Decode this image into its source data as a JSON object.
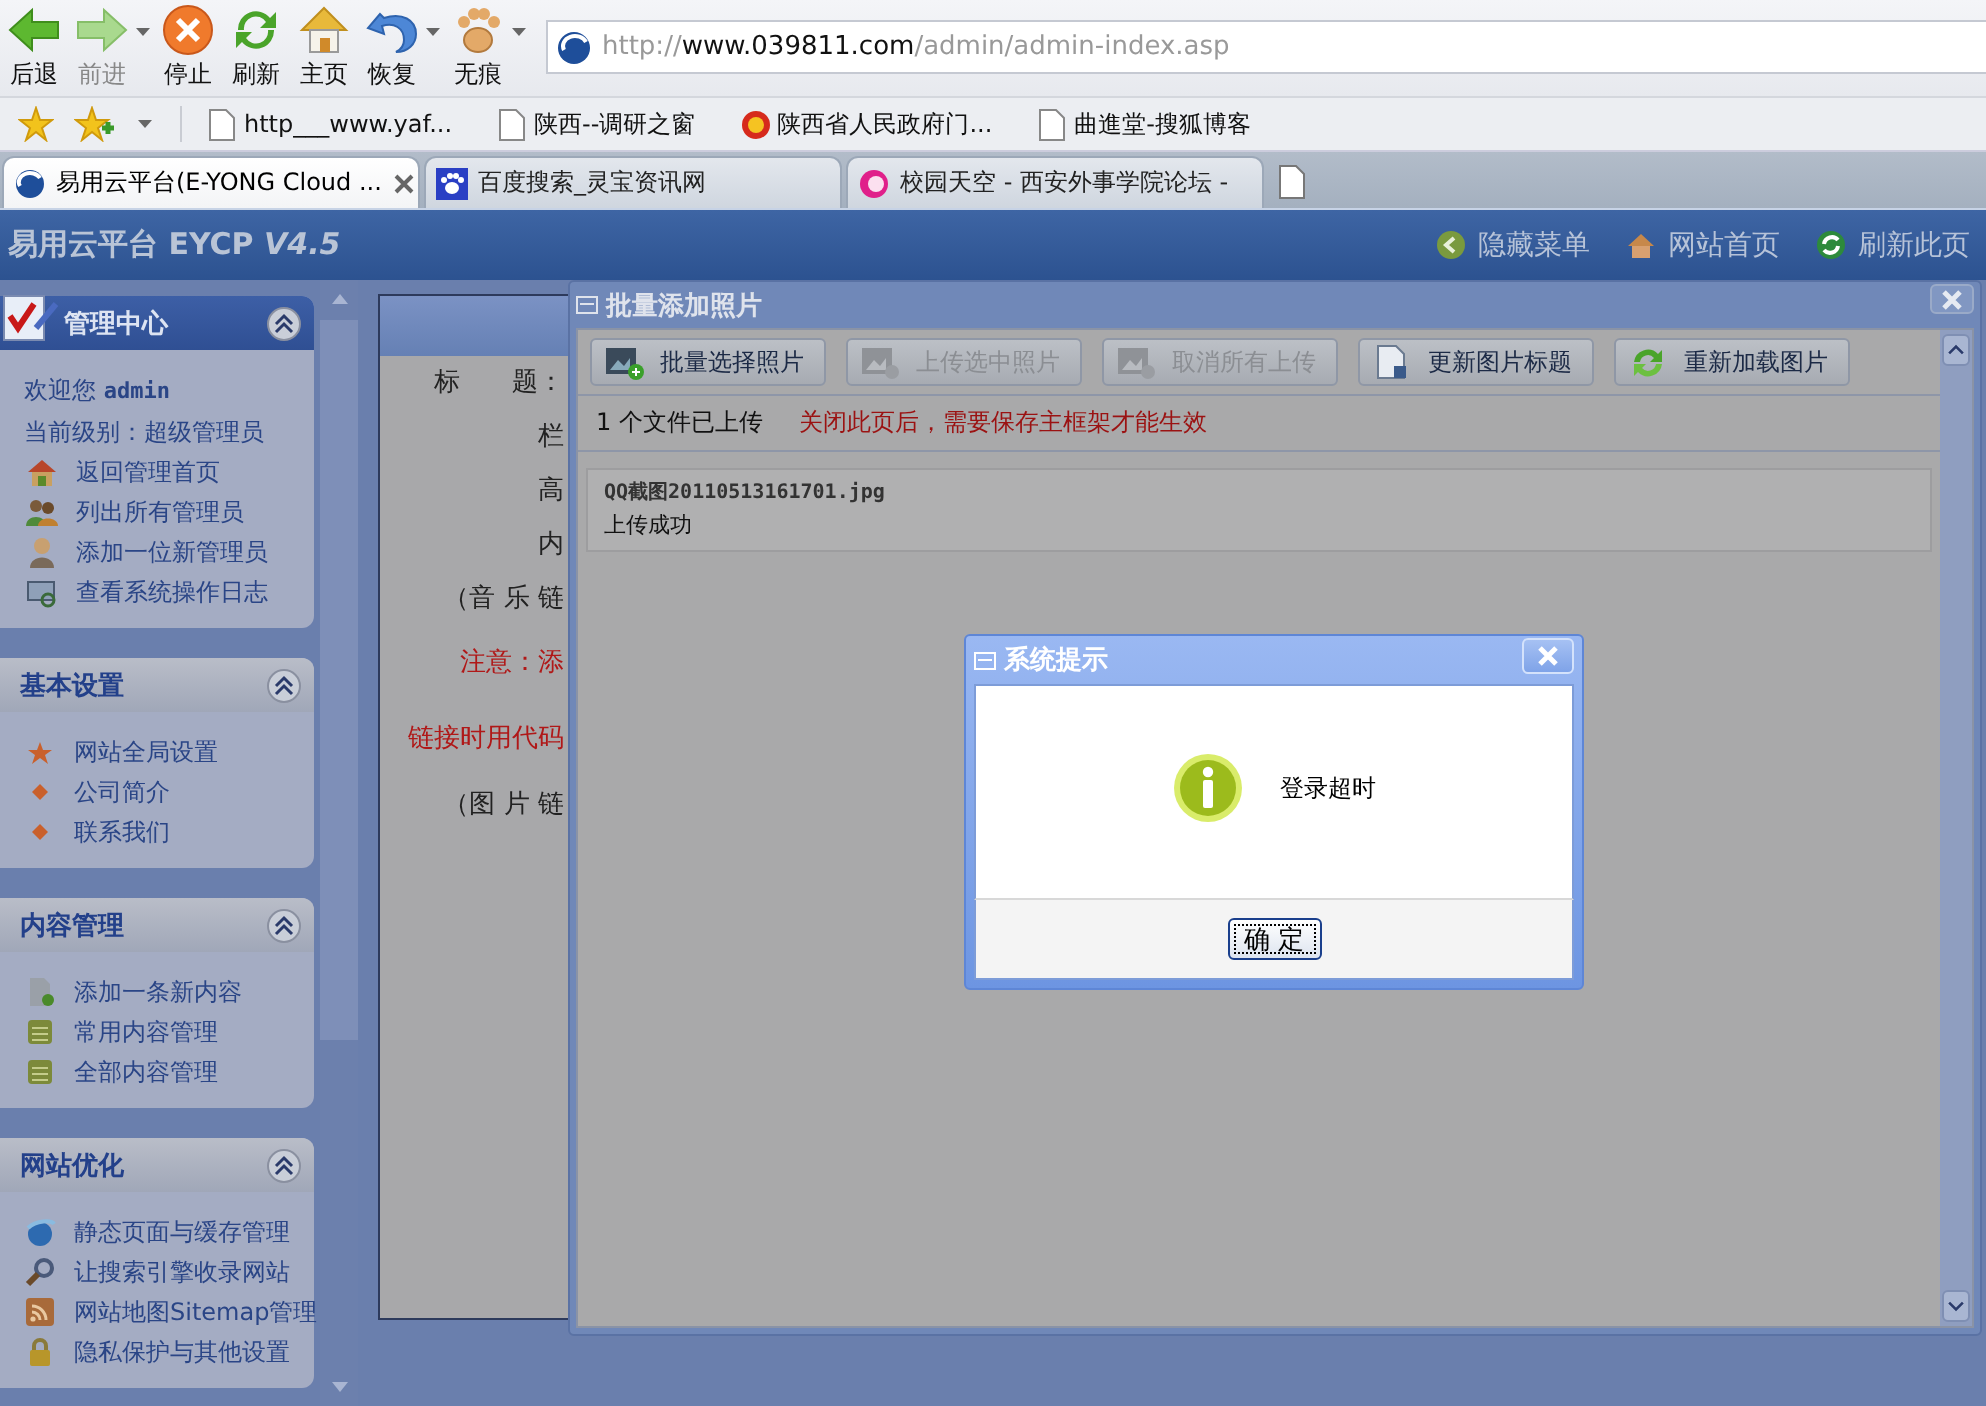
{
  "browser": {
    "nav_buttons": [
      {
        "label": "后退",
        "disabled": false
      },
      {
        "label": "前进",
        "disabled": true
      },
      {
        "label": "停止",
        "disabled": false
      },
      {
        "label": "刷新",
        "disabled": false
      },
      {
        "label": "主页",
        "disabled": false
      },
      {
        "label": "恢复",
        "disabled": false
      },
      {
        "label": "无痕",
        "disabled": false
      }
    ],
    "address": {
      "value": "http://**www.039811.com**/admin/admin-index.asp"
    },
    "bookmarks": [
      {
        "label": "http___www.yaf..."
      },
      {
        "label": "陕西--调研之窗"
      },
      {
        "label": "陕西省人民政府门..."
      },
      {
        "label": "曲進堂-搜狐博客"
      }
    ],
    "tabs": [
      {
        "label": "易用云平台(E-YONG Cloud ...",
        "selected": true
      },
      {
        "label": "百度搜索_灵宝资讯网",
        "selected": false
      },
      {
        "label": "校园天空 - 西安外事学院论坛 -",
        "selected": false
      }
    ]
  },
  "app": {
    "title": "易用云平台 EYCP *V4.5*",
    "header_links": [
      "隐藏菜单",
      "网站首页",
      "刷新此页"
    ]
  },
  "sidebar": {
    "panels": [
      {
        "kind": "main",
        "title": "管理中心",
        "expanded": true,
        "lines": [
          "欢迎您 **admin**",
          "当前级别：超级管理员"
        ],
        "items": [
          "返回管理首页",
          "列出所有管理员",
          "添加一位新管理员",
          "查看系统操作日志"
        ]
      },
      {
        "kind": "section",
        "title": "基本设置",
        "expanded": true,
        "items": [
          "网站全局设置",
          "公司简介",
          "联系我们"
        ]
      },
      {
        "kind": "section",
        "title": "内容管理",
        "expanded": true,
        "items": [
          "添加一条新内容",
          "常用内容管理",
          "全部内容管理"
        ]
      },
      {
        "kind": "section",
        "title": "网站优化",
        "expanded": true,
        "items": [
          "静态页面与缓存管理",
          "让搜索引擎收录网站",
          "网站地图Sitemap管理",
          "隐私保护与其他设置"
        ]
      }
    ]
  },
  "form": {
    "labels": [
      {
        "text": "标　　题：",
        "warning": false
      },
      {
        "text": "栏",
        "warning": false
      },
      {
        "text": "高",
        "warning": false
      },
      {
        "text": "内",
        "warning": false
      },
      {
        "text": "（音 乐 链",
        "warning": false
      },
      {
        "text": "注意：添",
        "warning": true
      },
      {
        "text": "链接时用代码",
        "warning": true
      },
      {
        "text": "（图 片 链",
        "warning": false
      }
    ]
  },
  "upload_dialog": {
    "title": "批量添加照片",
    "toolbar": [
      {
        "label": "批量选择照片",
        "disabled": false
      },
      {
        "label": "上传选中照片",
        "disabled": true
      },
      {
        "label": "取消所有上传",
        "disabled": true
      },
      {
        "label": "更新图片标题",
        "disabled": false
      },
      {
        "label": "重新加载图片",
        "disabled": false
      }
    ],
    "uploaded_count": "1 个文件已上传",
    "notice": "关闭此页后，需要保存主框架才能生效",
    "files": [
      {
        "name": "QQ截图20110513161701.jpg",
        "status": "上传成功"
      }
    ]
  },
  "alert": {
    "title": "系统提示",
    "message": "登录超时",
    "button": "确 定"
  }
}
